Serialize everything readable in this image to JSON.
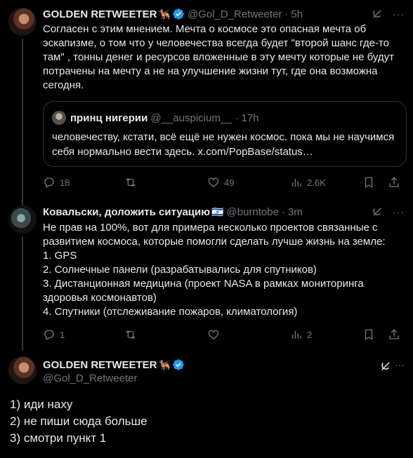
{
  "tweets": [
    {
      "name": "GOLDEN RETWEETER",
      "emoji": "🐕‍🦺",
      "handle": "@Gol_D_Retweeter",
      "time": "5h",
      "text": "Согласен с этим мнением. Мечта о космосе это опасная мечта об эскапизме, о том что у человечества всегда будет \"второй шанс где-то там\" , тонны денег и ресурсов вложенные в эту мечту которые не будут потрачены на мечту а не на улучшение жизни тут, где она возможна сегодня.",
      "quote": {
        "name": "принц нигерии",
        "handle": "@__auspicium__",
        "time": "17h",
        "text": "человечеству, кстати, всё ещё не нужен космос. пока мы не научимся себя нормально вести здесь. x.com/PopBase/status…"
      },
      "actions": {
        "replies": "18",
        "retweets": "",
        "likes": "49",
        "views": "2.6K"
      }
    },
    {
      "name": "Ковальски, доложить ситуацию",
      "emoji": "🇮🇱",
      "handle": "@burntobe",
      "time": "3m",
      "text": "Не прав на 100%, вот для примера несколько проектов связанные с развитием космоса, которые помогли сделать лучше жизнь на земле:\n1. GPS\n2. Солнечные панели (разрабатывались для спутников)\n3. Дистанционная медицина (проект NASA в рамках мониторинга здоровья космонавтов)\n4. Спутники (отслеживание пожаров, климатология)",
      "actions": {
        "replies": "1",
        "retweets": "",
        "likes": "",
        "views": "2"
      }
    }
  ],
  "reply": {
    "name": "GOLDEN RETWEETER",
    "emoji": "🐕‍🦺",
    "handle": "@Gol_D_Retweeter",
    "text": "1) иди наху\n2) не пиши сюда больше\n3) смотри пункт 1"
  },
  "colors": {
    "background": "#000000",
    "text": "#e7e9ea",
    "muted": "#71767b",
    "verified": "#1d9bf0",
    "border": "#2f3336"
  }
}
